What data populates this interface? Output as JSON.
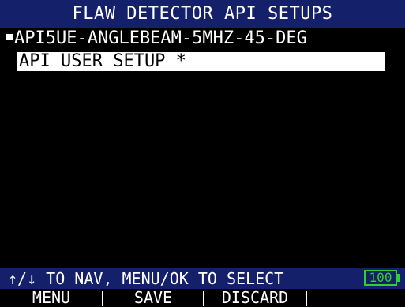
{
  "title": "FLAW DETECTOR API SETUPS",
  "items": [
    {
      "label": "API5UE-ANGLEBEAM-5MHZ-45-DEG",
      "marked": true
    },
    {
      "label": "API USER SETUP *",
      "selected": true
    }
  ],
  "status": {
    "hint": "↑/↓ TO NAV, MENU/OK TO SELECT",
    "battery": "100"
  },
  "softkeys": [
    "MENU",
    "SAVE",
    "DISCARD",
    ""
  ],
  "colors": {
    "bar": "#15206a",
    "background": "#000000",
    "battery": "#2fcf2f",
    "selection": "#ffffff"
  }
}
